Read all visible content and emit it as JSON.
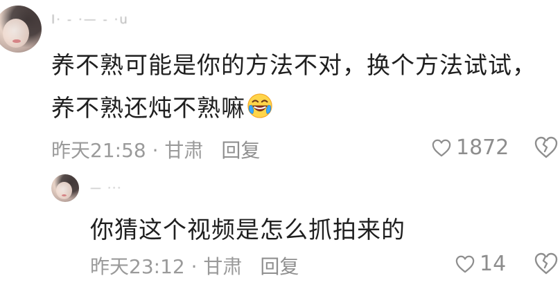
{
  "comments": [
    {
      "username": "Ⅰ·  -  ·—  - ·u",
      "text_line1": "养不熟可能是你的方法不对，换个方法试试，",
      "text_line2": "养不熟还炖不熟嘛",
      "emoji_icon": "laughing-tears-icon",
      "time_location": "昨天21:58 · 甘肃",
      "reply_label": "回复",
      "like_count": "1872"
    },
    {
      "username": "—  ···",
      "text": "你猜这个视频是怎么抓拍来的",
      "time_location": "昨天23:12 · 甘肃",
      "reply_label": "回复",
      "like_count": "14"
    }
  ]
}
